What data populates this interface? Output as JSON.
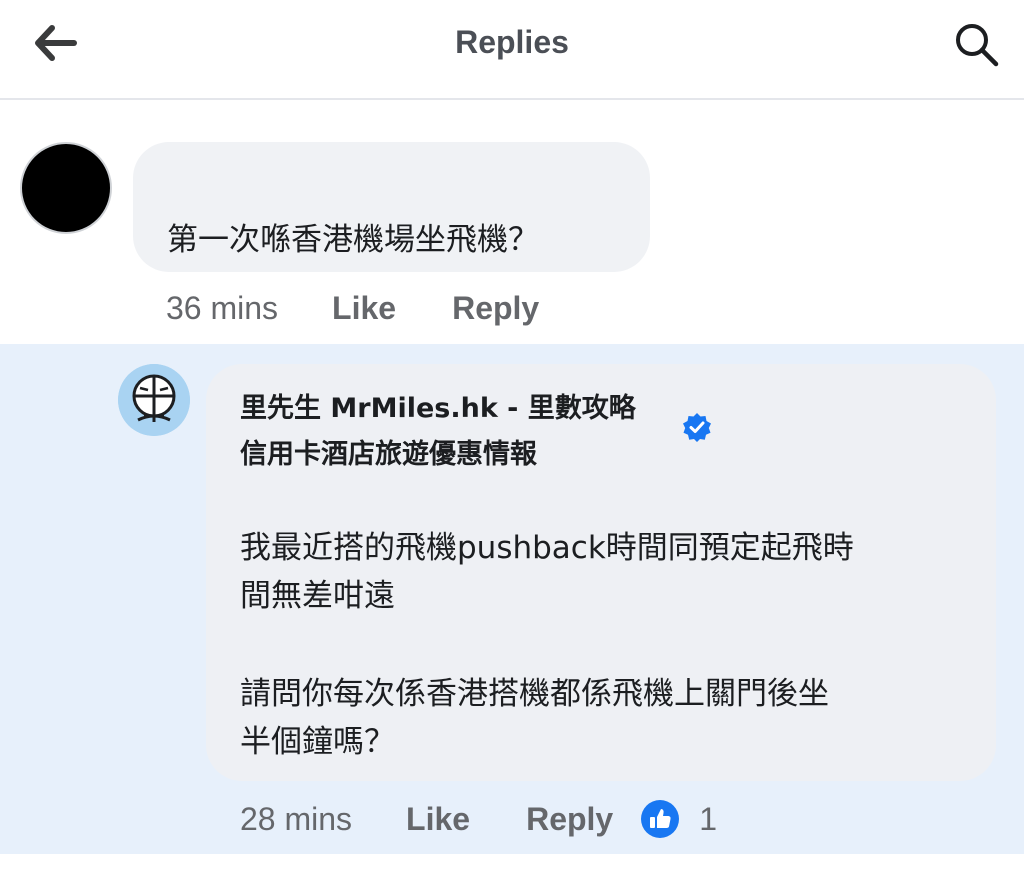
{
  "header": {
    "title": "Replies",
    "back_icon": "arrow-left-icon",
    "search_icon": "search-icon"
  },
  "comment1": {
    "text": "第一次喺香港機場坐飛機？",
    "time": "36 mins",
    "like_label": "Like",
    "reply_label": "Reply"
  },
  "comment2": {
    "author_line1": "里先生 MrMiles.hk - 里數攻略",
    "author_line2": "信用卡酒店旅遊優惠情報",
    "paragraph1_line1": "我最近搭的飛機pushback時間同預定起飛時",
    "paragraph1_line2": "間無差咁遠",
    "paragraph2_line1": "請問你每次係香港搭機都係飛機上關門後坐",
    "paragraph2_line2": "半個鐘嗎？",
    "time": "28 mins",
    "like_label": "Like",
    "reply_label": "Reply",
    "reaction_count": "1"
  },
  "colors": {
    "highlight_bg": "#e7f0fb",
    "bubble_bg": "#f0f2f5",
    "meta_text": "#65676b",
    "like_blue": "#1877f2",
    "verified_blue": "#1877f2"
  }
}
